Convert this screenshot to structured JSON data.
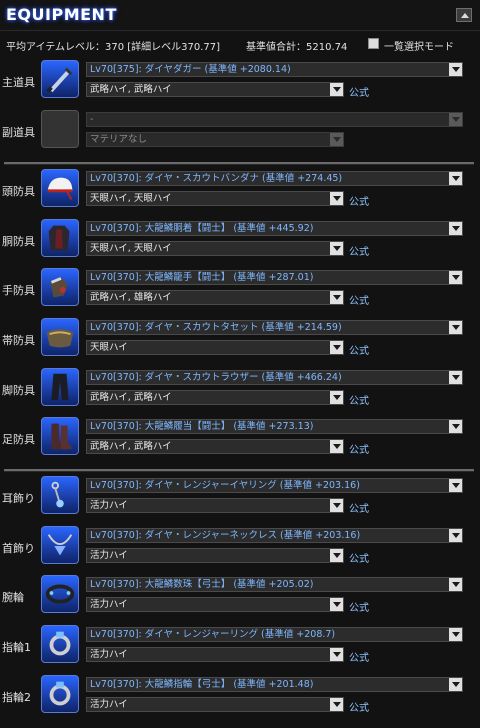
{
  "title": "EQUIPMENT",
  "summary": {
    "avg_item_level": "平均アイテムレベル：370 [詳細レベル370.77]",
    "base_total": "基準値合計：5210.74",
    "bulk_select_label": "一覧選択モード"
  },
  "official_label": "公式",
  "slots": [
    {
      "label": "主道具",
      "item_prefix": "Lv70[375]: ダイヤダガー",
      "item_suffix": "(基準値 +2080.14)",
      "materia": "武略ハイ, 武略ハイ",
      "icon": "dagger-icon"
    },
    {
      "label": "副道具",
      "item_prefix": "-",
      "item_suffix": "",
      "materia": "マテリアなし",
      "icon": "empty-slot-icon"
    },
    {
      "label": "頭防具",
      "item_prefix": "Lv70[370]: ダイヤ・スカウトバンダナ",
      "item_suffix": "(基準値 +274.45)",
      "materia": "天眼ハイ, 天眼ハイ",
      "icon": "bandana-icon"
    },
    {
      "label": "胴防具",
      "item_prefix": "Lv70[370]: 大龍鱗胴着【闘士】",
      "item_suffix": "(基準値 +445.92)",
      "materia": "天眼ハイ, 天眼ハイ",
      "icon": "body-armor-icon"
    },
    {
      "label": "手防具",
      "item_prefix": "Lv70[370]: 大龍鱗籠手【闘士】",
      "item_suffix": "(基準値 +287.01)",
      "materia": "武略ハイ, 雄略ハイ",
      "icon": "gloves-icon"
    },
    {
      "label": "帯防具",
      "item_prefix": "Lv70[370]: ダイヤ・スカウトタセット",
      "item_suffix": "(基準値 +214.59)",
      "materia": "天眼ハイ",
      "icon": "belt-icon"
    },
    {
      "label": "脚防具",
      "item_prefix": "Lv70[370]: ダイヤ・スカウトラウザー",
      "item_suffix": "(基準値 +466.24)",
      "materia": "武略ハイ, 武略ハイ",
      "icon": "trousers-icon"
    },
    {
      "label": "足防具",
      "item_prefix": "Lv70[370]: 大龍鱗履当【闘士】",
      "item_suffix": "(基準値 +273.13)",
      "materia": "武略ハイ, 武略ハイ",
      "icon": "boots-icon"
    },
    {
      "label": "耳飾り",
      "item_prefix": "Lv70[370]: ダイヤ・レンジャーイヤリング",
      "item_suffix": "(基準値 +203.16)",
      "materia": "活力ハイ",
      "icon": "earring-icon"
    },
    {
      "label": "首飾り",
      "item_prefix": "Lv70[370]: ダイヤ・レンジャーネックレス",
      "item_suffix": "(基準値 +203.16)",
      "materia": "活力ハイ",
      "icon": "necklace-icon"
    },
    {
      "label": "腕輪",
      "item_prefix": "Lv70[370]: 大龍鱗数珠【弓士】",
      "item_suffix": "(基準値 +205.02)",
      "materia": "活力ハイ",
      "icon": "bracelet-icon"
    },
    {
      "label": "指輪1",
      "item_prefix": "Lv70[370]: ダイヤ・レンジャーリング",
      "item_suffix": "(基準値 +208.7)",
      "materia": "活力ハイ",
      "icon": "ring-icon"
    },
    {
      "label": "指輪2",
      "item_prefix": "Lv70[370]: 大龍鱗指輪【弓士】",
      "item_suffix": "(基準値 +201.48)",
      "materia": "活力ハイ",
      "icon": "ring-icon"
    }
  ]
}
